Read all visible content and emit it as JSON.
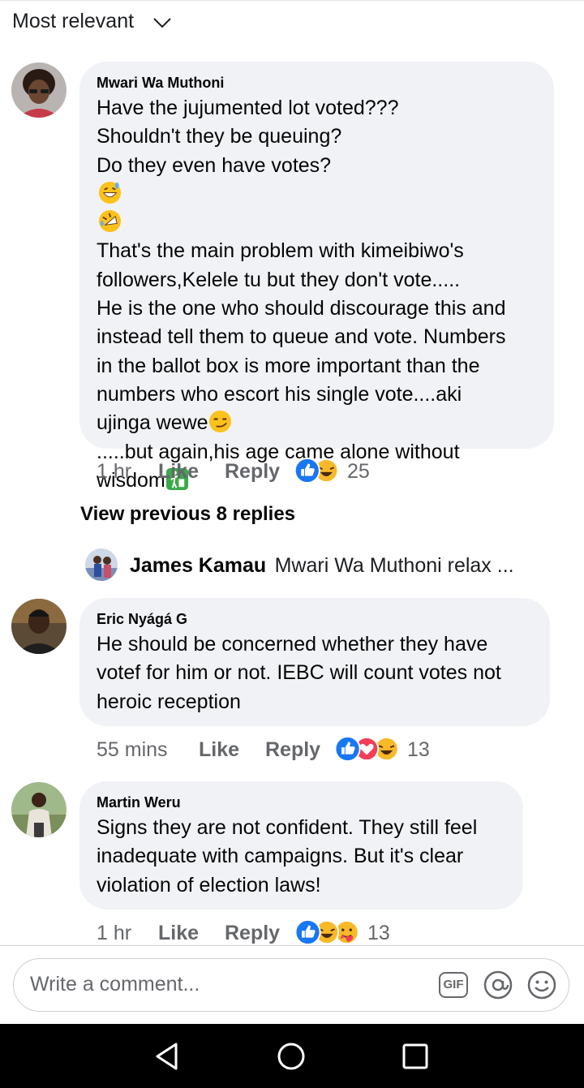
{
  "sort": {
    "label": "Most relevant"
  },
  "comments": [
    {
      "author": "Mwari Wa Muthoni",
      "lines": [
        "Have the jujumented lot voted???",
        "Shouldn't they be queuing?",
        "Do they even have votes?",
        "That's the main problem with kimeibiwo's",
        "followers,Kelele tu but they don't vote.....",
        "He is the one who should discourage this and",
        "instead tell them to queue and vote. Numbers",
        "in the ballot box is more important than the",
        "numbers who escort his single  vote....aki",
        "ujinga wewe",
        ".....but again,his age came alone without",
        "wisdom"
      ],
      "time": "1 hr",
      "like": "Like",
      "reply": "Reply",
      "reaction_count": "25"
    },
    {
      "author": "Eric Nyágá G",
      "lines": [
        "He should be concerned whether they have",
        "votef for him or not. IEBC will count votes not",
        "heroic reception"
      ],
      "time": "55 mins",
      "like": "Like",
      "reply": "Reply",
      "reaction_count": "13"
    },
    {
      "author": "Martin Weru",
      "lines": [
        "Signs they are not confident. They still feel",
        "inadequate with campaigns. But it's clear",
        "violation of election laws!"
      ],
      "time": "1 hr",
      "like": "Like",
      "reply": "Reply",
      "reaction_count": "13"
    }
  ],
  "view_previous": "View previous 8 replies",
  "reply_preview": {
    "author": "James Kamau",
    "text": "Mwari Wa Muthoni relax ..."
  },
  "composer": {
    "placeholder": "Write a comment...",
    "gif_label": "GIF"
  },
  "colors": {
    "like_blue": "#1877f2",
    "love_red": "#f33e58",
    "haha_yellow": "#f7b928",
    "bubble_bg": "#f0f2f5"
  }
}
